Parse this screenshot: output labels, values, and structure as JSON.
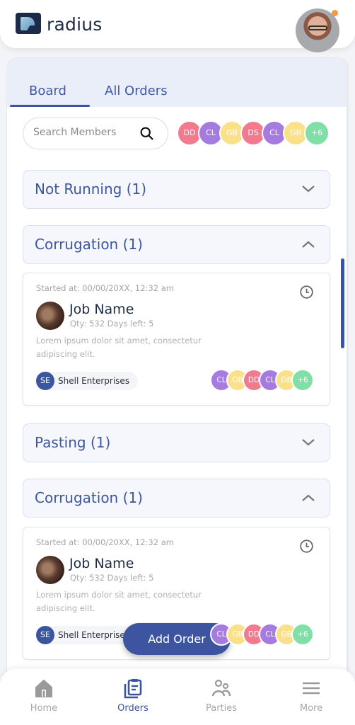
{
  "app": {
    "name": "radius"
  },
  "header": {
    "notification_color": "#f39a3c"
  },
  "tabs": [
    {
      "label": "Board",
      "active": true
    },
    {
      "label": "All Orders",
      "active": false
    }
  ],
  "search": {
    "placeholder": "Search Members",
    "value": ""
  },
  "members": [
    {
      "initials": "DD",
      "color": "#f27a8f"
    },
    {
      "initials": "CL",
      "color": "#a57be0"
    },
    {
      "initials": "GB",
      "color": "#fbe08a"
    },
    {
      "initials": "DS",
      "color": "#f27a8f"
    },
    {
      "initials": "CL",
      "color": "#a57be0"
    },
    {
      "initials": "GB",
      "color": "#fbe08a"
    },
    {
      "initials": "+6",
      "color": "#7fdfa6"
    }
  ],
  "sections": [
    {
      "label": "Not Running (1)",
      "expanded": false
    },
    {
      "label": "Corrugation (1)",
      "expanded": true
    },
    {
      "label": "Pasting (1)",
      "expanded": false
    },
    {
      "label": "Corrugation (1)",
      "expanded": true
    }
  ],
  "cards": [
    {
      "started": "Started at:  00/00/20XX, 12:32 am",
      "job_name": "Job Name",
      "meta": "Qty: 532   Days left: 5",
      "description": "Lorem ipsum dolor sit amet, consectetur adipiscing elit.",
      "party_initials": "SE",
      "party_name": "Shell Enterprises",
      "members": [
        {
          "initials": "CL",
          "color": "#a57be0"
        },
        {
          "initials": "GB",
          "color": "#fbe08a"
        },
        {
          "initials": "DD",
          "color": "#f27a8f"
        },
        {
          "initials": "CL",
          "color": "#a57be0"
        },
        {
          "initials": "GB",
          "color": "#fbe08a"
        },
        {
          "initials": "+6",
          "color": "#7fdfa6"
        }
      ]
    },
    {
      "started": "Started at:  00/00/20XX, 12:32 am",
      "job_name": "Job Name",
      "meta": "Qty: 532   Days left: 5",
      "description": "Lorem ipsum dolor sit amet, consectetur adipiscing elit.",
      "party_initials": "SE",
      "party_name": "Shell Enterprises",
      "members": [
        {
          "initials": "CL",
          "color": "#a57be0"
        },
        {
          "initials": "GB",
          "color": "#fbe08a"
        },
        {
          "initials": "DD",
          "color": "#f27a8f"
        },
        {
          "initials": "CL",
          "color": "#a57be0"
        },
        {
          "initials": "GB",
          "color": "#fbe08a"
        },
        {
          "initials": "+6",
          "color": "#7fdfa6"
        }
      ]
    }
  ],
  "fab": {
    "label": "Add Order"
  },
  "nav": [
    {
      "label": "Home",
      "icon": "home-icon",
      "active": false
    },
    {
      "label": "Orders",
      "icon": "orders-icon",
      "active": true
    },
    {
      "label": "Parties",
      "icon": "parties-icon",
      "active": false
    },
    {
      "label": "More",
      "icon": "menu-icon",
      "active": false
    }
  ],
  "colors": {
    "accent": "#3b54a0",
    "section_bg": "#f5f7fc",
    "tab_bg": "#eaeef8"
  }
}
